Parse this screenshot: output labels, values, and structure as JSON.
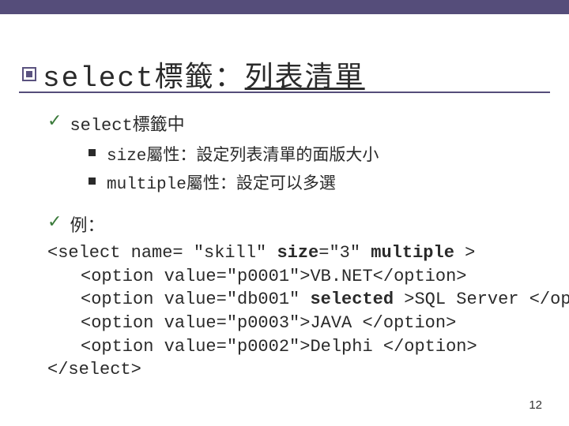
{
  "title": {
    "prefix": "select標籤：",
    "main": "列表清單"
  },
  "bullets": {
    "check1": "select標籤中",
    "sub1": "size屬性：設定列表清單的面版大小",
    "sub2": "multiple屬性：設定可以多選",
    "check2": "例："
  },
  "code": {
    "l1a": "<select name= \"skill\" ",
    "l1b_size": "size",
    "l1b_eq": "=\"3\" ",
    "l1c_multiple": "multiple",
    "l1d": " >",
    "l2a": "<option value=\"p0001\">VB.NET</option>",
    "l3a": "<option value=\"db001\" ",
    "l3b_sel": "selected",
    "l3c": " >SQL Server </option>",
    "l4": "<option value=\"p0003\">JAVA </option>",
    "l5": "<option value=\"p0002\">Delphi </option>",
    "l6": "</select>"
  },
  "page": "12"
}
